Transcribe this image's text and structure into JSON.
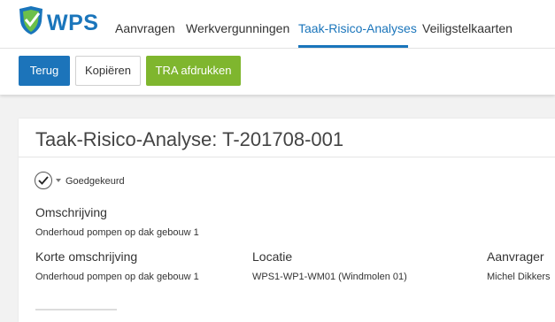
{
  "nav": {
    "brand": "WPS",
    "items": [
      {
        "label": "Aanvragen"
      },
      {
        "label": "Werkvergunningen"
      },
      {
        "label": "Taak-Risico-Analyses"
      },
      {
        "label": "Veiligstelkaarten"
      }
    ]
  },
  "toolbar": {
    "back_label": "Terug",
    "copy_label": "Kopiëren",
    "print_label": "TRA afdrukken"
  },
  "page": {
    "title": "Taak-Risico-Analyse: T-201708-001",
    "status": "Goedgekeurd",
    "fields": {
      "omschrijving_label": "Omschrijving",
      "omschrijving_value": "Onderhoud pompen op dak gebouw 1",
      "korte_label": "Korte omschrijving",
      "korte_value": "Onderhoud pompen op dak gebouw 1",
      "locatie_label": "Locatie",
      "locatie_value": "WPS1-WP1-WM01 (Windmolen 01)",
      "aanvrager_label": "Aanvrager",
      "aanvrager_value": "Michel Dikkers"
    }
  },
  "colors": {
    "primary": "#1a75bb",
    "green": "#7fb62e"
  }
}
